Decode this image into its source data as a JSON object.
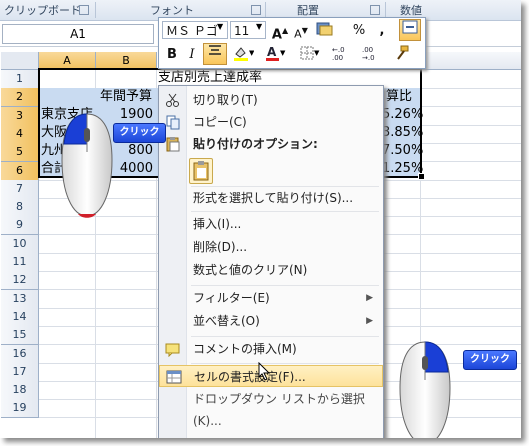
{
  "ribbon": {
    "groups": [
      "クリップボード",
      "フォント",
      "配置",
      "数値"
    ]
  },
  "name_box": {
    "value": "A1"
  },
  "columns": [
    "A",
    "B"
  ],
  "rows": [
    "1",
    "2",
    "3",
    "4",
    "5",
    "6",
    "7",
    "8",
    "9",
    "10",
    "11",
    "12",
    "13",
    "14",
    "15",
    "16",
    "17",
    "18",
    "19"
  ],
  "sheet": {
    "title": "支店別売上達成率",
    "header_budget": "年間予算",
    "header_ratio": "算比",
    "branches": [
      "東京支店",
      "大阪",
      "九州",
      "合計"
    ],
    "budgets": [
      "1900",
      "",
      "800",
      "4000"
    ],
    "ratios": [
      "5.26%",
      "3.85%",
      "7.50%",
      "1.25%"
    ]
  },
  "mini_toolbar": {
    "font_name": "ＭＳ Ｐゴ",
    "font_size": "11",
    "bold": "B",
    "italic": "I",
    "percent": "%",
    "comma": ","
  },
  "context_menu": {
    "items": [
      {
        "label": "切り取り(T)",
        "icon": "scissors-icon"
      },
      {
        "label": "コピー(C)",
        "icon": "copy-icon"
      },
      {
        "label": "貼り付けのオプション:",
        "icon": "paste-icon",
        "header": true
      },
      {
        "label": "形式を選択して貼り付け(S)..."
      },
      {
        "label": "挿入(I)..."
      },
      {
        "label": "削除(D)..."
      },
      {
        "label": "数式と値のクリア(N)"
      },
      {
        "label": "フィルター(E)",
        "submenu": true
      },
      {
        "label": "並べ替え(O)",
        "submenu": true
      },
      {
        "label": "コメントの挿入(M)",
        "icon": "comment-icon"
      },
      {
        "label": "セルの書式設定(F)...",
        "icon": "format-cells-icon",
        "highlighted": true
      },
      {
        "label": "ドロップダウン リストから選択(K)..."
      }
    ]
  },
  "callouts": {
    "left_click": "クリック",
    "right_click": "クリック"
  },
  "colors": {
    "selection": "#c9dbf1",
    "header_selected": "#f1c15f",
    "menu_highlight": "#fde29b",
    "callout": "#1c46d8"
  }
}
